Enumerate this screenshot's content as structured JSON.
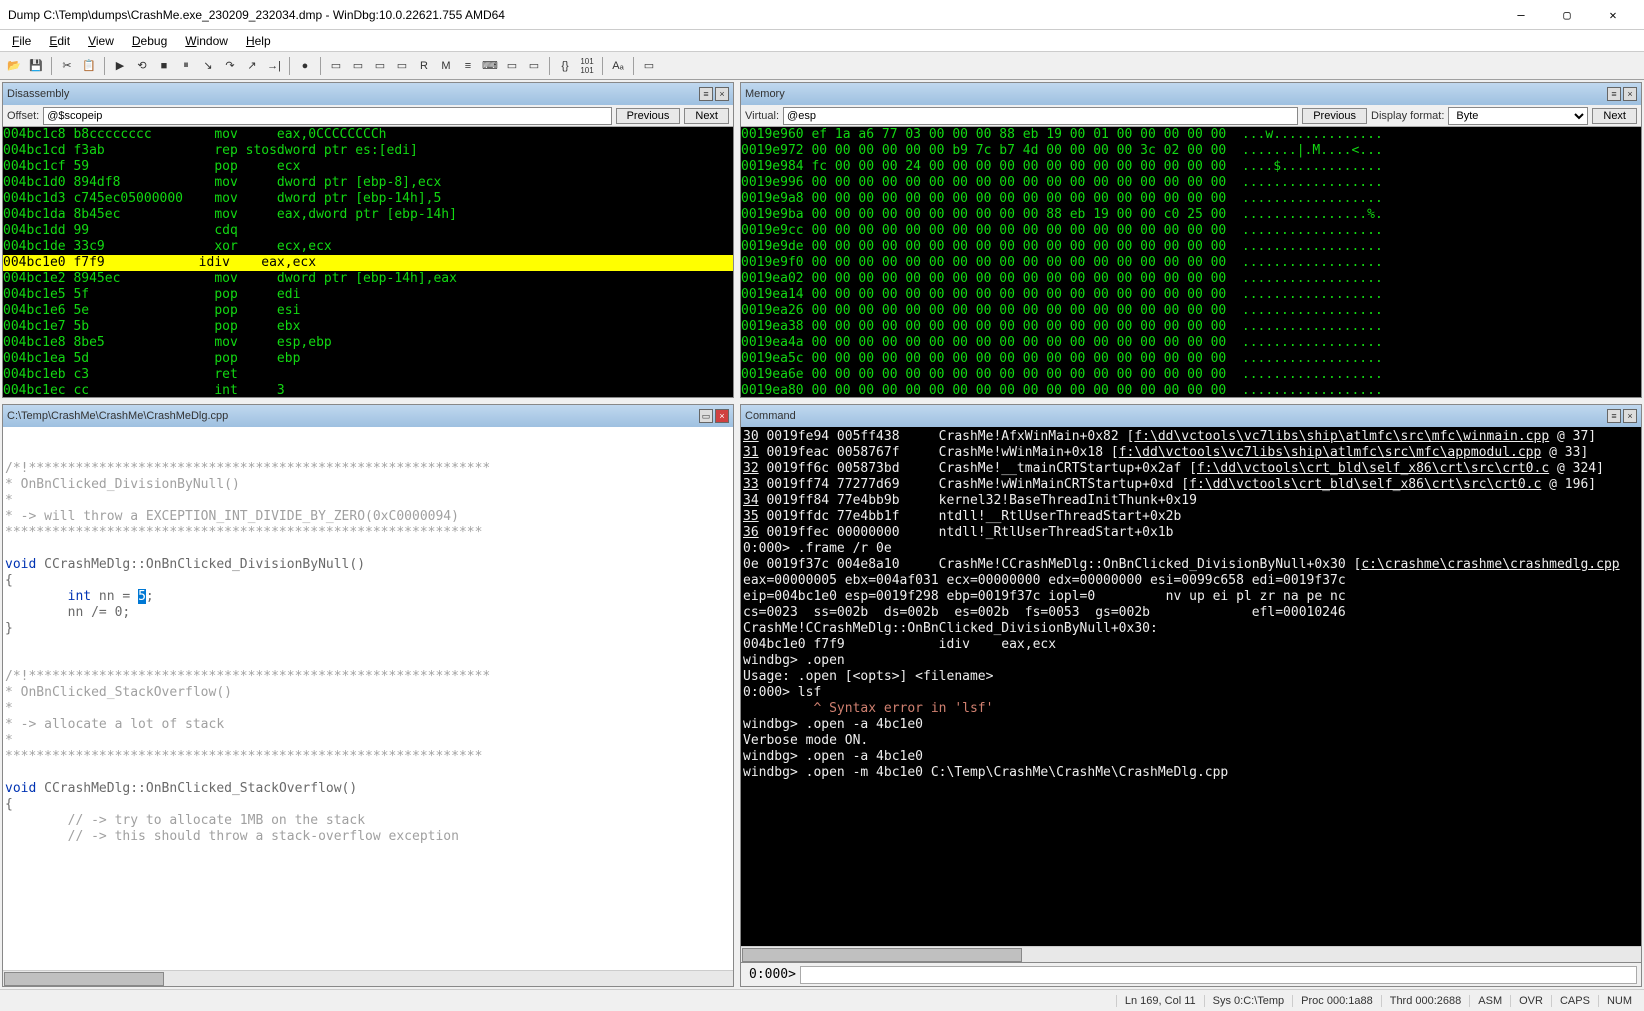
{
  "title": "Dump C:\\Temp\\dumps\\CrashMe.exe_230209_232034.dmp - WinDbg:10.0.22621.755 AMD64",
  "menu": [
    "File",
    "Edit",
    "View",
    "Debug",
    "Window",
    "Help"
  ],
  "panes": {
    "disasm": {
      "title": "Disassembly",
      "offset_label": "Offset:",
      "offset_value": "@$scopeip",
      "prev": "Previous",
      "next": "Next",
      "lines": [
        {
          "addr": "004bc1c8",
          "bytes": "b8cccccccc",
          "mnem": "mov",
          "ops": "eax,0CCCCCCCCh",
          "hl": false
        },
        {
          "addr": "004bc1cd",
          "bytes": "f3ab",
          "mnem": "rep stos",
          "ops": "dword ptr es:[edi]",
          "hl": false
        },
        {
          "addr": "004bc1cf",
          "bytes": "59",
          "mnem": "pop",
          "ops": "ecx",
          "hl": false
        },
        {
          "addr": "004bc1d0",
          "bytes": "894df8",
          "mnem": "mov",
          "ops": "dword ptr [ebp-8],ecx",
          "hl": false
        },
        {
          "addr": "004bc1d3",
          "bytes": "c745ec05000000",
          "mnem": "mov",
          "ops": "dword ptr [ebp-14h],5",
          "hl": false
        },
        {
          "addr": "004bc1da",
          "bytes": "8b45ec",
          "mnem": "mov",
          "ops": "eax,dword ptr [ebp-14h]",
          "hl": false
        },
        {
          "addr": "004bc1dd",
          "bytes": "99",
          "mnem": "cdq",
          "ops": "",
          "hl": false
        },
        {
          "addr": "004bc1de",
          "bytes": "33c9",
          "mnem": "xor",
          "ops": "ecx,ecx",
          "hl": false
        },
        {
          "addr": "004bc1e0",
          "bytes": "f7f9",
          "mnem": "idiv",
          "ops": "eax,ecx",
          "hl": true
        },
        {
          "addr": "004bc1e2",
          "bytes": "8945ec",
          "mnem": "mov",
          "ops": "dword ptr [ebp-14h],eax",
          "hl": false
        },
        {
          "addr": "004bc1e5",
          "bytes": "5f",
          "mnem": "pop",
          "ops": "edi",
          "hl": false
        },
        {
          "addr": "004bc1e6",
          "bytes": "5e",
          "mnem": "pop",
          "ops": "esi",
          "hl": false
        },
        {
          "addr": "004bc1e7",
          "bytes": "5b",
          "mnem": "pop",
          "ops": "ebx",
          "hl": false
        },
        {
          "addr": "004bc1e8",
          "bytes": "8be5",
          "mnem": "mov",
          "ops": "esp,ebp",
          "hl": false
        },
        {
          "addr": "004bc1ea",
          "bytes": "5d",
          "mnem": "pop",
          "ops": "ebp",
          "hl": false
        },
        {
          "addr": "004bc1eb",
          "bytes": "c3",
          "mnem": "ret",
          "ops": "",
          "hl": false
        },
        {
          "addr": "004bc1ec",
          "bytes": "cc",
          "mnem": "int",
          "ops": "3",
          "hl": false
        }
      ]
    },
    "memory": {
      "title": "Memory",
      "virtual_label": "Virtual:",
      "virtual_value": "@esp",
      "format_label": "Display format:",
      "format_value": "Byte",
      "prev": "Previous",
      "next": "Next",
      "lines": [
        {
          "addr": "0019e960",
          "hex": "ef 1a a6 77 03 00 00 00 88 eb 19 00 01 00 00 00 00 00",
          "asc": "...w.............."
        },
        {
          "addr": "0019e972",
          "hex": "00 00 00 00 00 00 b9 7c b7 4d 00 00 00 00 3c 02 00 00",
          "asc": ".......|.M....<..."
        },
        {
          "addr": "0019e984",
          "hex": "fc 00 00 00 24 00 00 00 00 00 00 00 00 00 00 00 00 00",
          "asc": "....$............."
        },
        {
          "addr": "0019e996",
          "hex": "00 00 00 00 00 00 00 00 00 00 00 00 00 00 00 00 00 00",
          "asc": ".................."
        },
        {
          "addr": "0019e9a8",
          "hex": "00 00 00 00 00 00 00 00 00 00 00 00 00 00 00 00 00 00",
          "asc": ".................."
        },
        {
          "addr": "0019e9ba",
          "hex": "00 00 00 00 00 00 00 00 00 00 88 eb 19 00 00 c0 25 00",
          "asc": "................%."
        },
        {
          "addr": "0019e9cc",
          "hex": "00 00 00 00 00 00 00 00 00 00 00 00 00 00 00 00 00 00",
          "asc": ".................."
        },
        {
          "addr": "0019e9de",
          "hex": "00 00 00 00 00 00 00 00 00 00 00 00 00 00 00 00 00 00",
          "asc": ".................."
        },
        {
          "addr": "0019e9f0",
          "hex": "00 00 00 00 00 00 00 00 00 00 00 00 00 00 00 00 00 00",
          "asc": ".................."
        },
        {
          "addr": "0019ea02",
          "hex": "00 00 00 00 00 00 00 00 00 00 00 00 00 00 00 00 00 00",
          "asc": ".................."
        },
        {
          "addr": "0019ea14",
          "hex": "00 00 00 00 00 00 00 00 00 00 00 00 00 00 00 00 00 00",
          "asc": ".................."
        },
        {
          "addr": "0019ea26",
          "hex": "00 00 00 00 00 00 00 00 00 00 00 00 00 00 00 00 00 00",
          "asc": ".................."
        },
        {
          "addr": "0019ea38",
          "hex": "00 00 00 00 00 00 00 00 00 00 00 00 00 00 00 00 00 00",
          "asc": ".................."
        },
        {
          "addr": "0019ea4a",
          "hex": "00 00 00 00 00 00 00 00 00 00 00 00 00 00 00 00 00 00",
          "asc": ".................."
        },
        {
          "addr": "0019ea5c",
          "hex": "00 00 00 00 00 00 00 00 00 00 00 00 00 00 00 00 00 00",
          "asc": ".................."
        },
        {
          "addr": "0019ea6e",
          "hex": "00 00 00 00 00 00 00 00 00 00 00 00 00 00 00 00 00 00",
          "asc": ".................."
        },
        {
          "addr": "0019ea80",
          "hex": "00 00 00 00 00 00 00 00 00 00 00 00 00 00 00 00 00 00",
          "asc": ".................."
        }
      ]
    },
    "source": {
      "title": "C:\\Temp\\CrashMe\\CrashMe\\CrashMeDlg.cpp",
      "lines": [
        {
          "t": "",
          "c": "plain"
        },
        {
          "t": "",
          "c": "plain"
        },
        {
          "t": "/*!***********************************************************",
          "c": "comment"
        },
        {
          "t": "* OnBnClicked_DivisionByNull()",
          "c": "comment"
        },
        {
          "t": "*",
          "c": "comment"
        },
        {
          "t": "* -> will throw a EXCEPTION_INT_DIVIDE_BY_ZERO(0xC0000094)",
          "c": "comment"
        },
        {
          "t": "*************************************************************",
          "c": "comment"
        },
        {
          "t": "",
          "c": "plain"
        },
        {
          "t": "void CCrashMeDlg::OnBnClicked_DivisionByNull()",
          "c": "plain"
        },
        {
          "t": "{",
          "c": "plain"
        },
        {
          "t": "        int nn = 5;",
          "c": "plain",
          "sel5": true
        },
        {
          "t": "        nn /= 0;",
          "c": "plain"
        },
        {
          "t": "}",
          "c": "plain"
        },
        {
          "t": "",
          "c": "plain"
        },
        {
          "t": "",
          "c": "plain"
        },
        {
          "t": "/*!***********************************************************",
          "c": "comment"
        },
        {
          "t": "* OnBnClicked_StackOverflow()",
          "c": "comment"
        },
        {
          "t": "*",
          "c": "comment"
        },
        {
          "t": "* -> allocate a lot of stack",
          "c": "comment"
        },
        {
          "t": "*",
          "c": "comment"
        },
        {
          "t": "*************************************************************",
          "c": "comment"
        },
        {
          "t": "",
          "c": "plain"
        },
        {
          "t": "void CCrashMeDlg::OnBnClicked_StackOverflow()",
          "c": "plain"
        },
        {
          "t": "{",
          "c": "plain"
        },
        {
          "t": "        // -> try to allocate 1MB on the stack",
          "c": "comment"
        },
        {
          "t": "        // -> this should throw a stack-overflow exception",
          "c": "comment"
        }
      ]
    },
    "command": {
      "title": "Command",
      "prompt": "0:000>",
      "input": "",
      "lines": [
        {
          "seg": [
            {
              "t": "30",
              "u": true
            },
            {
              "t": " 0019fe94 005ff438     CrashMe!AfxWinMain+0x82 ["
            },
            {
              "t": "f:\\dd\\vctools\\vc7libs\\ship\\atlmfc\\src\\mfc\\winmain.cpp",
              "u": true
            },
            {
              "t": " @ 37]"
            }
          ]
        },
        {
          "seg": [
            {
              "t": "31",
              "u": true
            },
            {
              "t": " 0019feac 0058767f     CrashMe!wWinMain+0x18 ["
            },
            {
              "t": "f:\\dd\\vctools\\vc7libs\\ship\\atlmfc\\src\\mfc\\appmodul.cpp",
              "u": true
            },
            {
              "t": " @ 33]"
            }
          ]
        },
        {
          "seg": [
            {
              "t": "32",
              "u": true
            },
            {
              "t": " 0019ff6c 005873bd     CrashMe!__tmainCRTStartup+0x2af ["
            },
            {
              "t": "f:\\dd\\vctools\\crt_bld\\self_x86\\crt\\src\\crt0.c",
              "u": true
            },
            {
              "t": " @ 324]"
            }
          ]
        },
        {
          "seg": [
            {
              "t": "33",
              "u": true
            },
            {
              "t": " 0019ff74 77277d69     CrashMe!wWinMainCRTStartup+0xd ["
            },
            {
              "t": "f:\\dd\\vctools\\crt_bld\\self_x86\\crt\\src\\crt0.c",
              "u": true
            },
            {
              "t": " @ 196]"
            }
          ]
        },
        {
          "seg": [
            {
              "t": "34",
              "u": true
            },
            {
              "t": " 0019ff84 77e4bb9b     kernel32!BaseThreadInitThunk+0x19"
            }
          ]
        },
        {
          "seg": [
            {
              "t": "35",
              "u": true
            },
            {
              "t": " 0019ffdc 77e4bb1f     ntdll!__RtlUserThreadStart+0x2b"
            }
          ]
        },
        {
          "seg": [
            {
              "t": "36",
              "u": true
            },
            {
              "t": " 0019ffec 00000000     ntdll!_RtlUserThreadStart+0x1b"
            }
          ]
        },
        {
          "seg": [
            {
              "t": "0:000> .frame /r 0e"
            }
          ]
        },
        {
          "seg": [
            {
              "t": "0e 0019f37c 004e8a10     CrashMe!CCrashMeDlg::OnBnClicked_DivisionByNull+0x30 ["
            },
            {
              "t": "c:\\crashme\\crashme\\crashmedlg.cpp",
              "u": true
            }
          ]
        },
        {
          "seg": [
            {
              "t": "eax=00000005 ebx=004af031 ecx=00000000 edx=00000000 esi=0099c658 edi=0019f37c"
            }
          ]
        },
        {
          "seg": [
            {
              "t": "eip=004bc1e0 esp=0019f298 ebp=0019f37c iopl=0         nv up ei pl zr na pe nc"
            }
          ]
        },
        {
          "seg": [
            {
              "t": "cs=0023  ss=002b  ds=002b  es=002b  fs=0053  gs=002b             efl=00010246"
            }
          ]
        },
        {
          "seg": [
            {
              "t": "CrashMe!CCrashMeDlg::OnBnClicked_DivisionByNull+0x30:"
            }
          ]
        },
        {
          "seg": [
            {
              "t": "004bc1e0 f7f9            idiv    eax,ecx"
            }
          ]
        },
        {
          "seg": [
            {
              "t": "windbg> .open"
            }
          ]
        },
        {
          "seg": [
            {
              "t": "Usage: .open [<opts>] <filename>"
            }
          ]
        },
        {
          "seg": [
            {
              "t": "0:000> lsf"
            }
          ]
        },
        {
          "seg": [
            {
              "t": "         ^ Syntax error in 'lsf'",
              "err": true
            }
          ]
        },
        {
          "seg": [
            {
              "t": "windbg> .open -a 4bc1e0"
            }
          ]
        },
        {
          "seg": [
            {
              "t": "Verbose mode ON."
            }
          ]
        },
        {
          "seg": [
            {
              "t": "windbg> .open -a 4bc1e0"
            }
          ]
        },
        {
          "seg": [
            {
              "t": "windbg> .open -m 4bc1e0 C:\\Temp\\CrashMe\\CrashMe\\CrashMeDlg.cpp"
            }
          ]
        }
      ]
    }
  },
  "status": {
    "line": "Ln 169, Col 11",
    "sys": "Sys 0:C:\\Temp",
    "proc": "Proc 000:1a88",
    "thrd": "Thrd 000:2688",
    "asm": "ASM",
    "ovr": "OVR",
    "caps": "CAPS",
    "num": "NUM"
  }
}
